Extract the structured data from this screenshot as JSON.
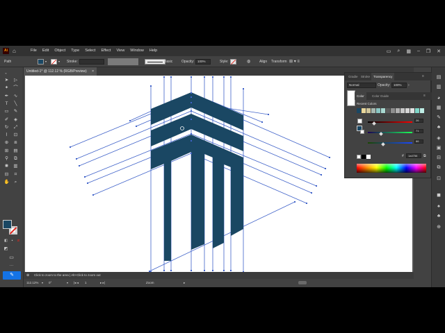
{
  "app": {
    "logo": "Ai",
    "menus": [
      "File",
      "Edit",
      "Object",
      "Type",
      "Select",
      "Effect",
      "View",
      "Window",
      "Help"
    ]
  },
  "control_bar": {
    "selection_label": "Path",
    "stroke_label": "Stroke:",
    "brush_label": "Basic",
    "opacity_label": "Opacity:",
    "opacity_value": "100%",
    "style_label": "Style:",
    "align_label": "Align",
    "transform_label": "Transform"
  },
  "document": {
    "tab_title": "Untitled-1* @ 112.12 % (RGB/Preview)",
    "close_glyph": "×"
  },
  "status": {
    "hint": "Click to zoom to the area  |  Alt+Click to zoom out",
    "zoom": "112.12%",
    "rotation": "0°",
    "artboard_num": "1",
    "tool_name": "Zoom"
  },
  "panels": {
    "top_tabs": [
      "Gradie",
      "Stroke",
      "Transparency"
    ],
    "blend_mode": "Normal",
    "opacity_label": "Opacity:",
    "opacity_value": "100%",
    "color_tabs": [
      "Color",
      "Color Guide"
    ],
    "recent_colors_label": "Recent Colors",
    "r_value": "26",
    "g_value": "71",
    "b_value": "86",
    "hex_label": "#",
    "hex_value": "1a4756"
  },
  "colors": {
    "accent_fill": "#1a4763",
    "guide_line": "#3f62c9",
    "recent": [
      "#1a4763",
      "#e9d79b",
      "#cfc59a",
      "#a7b8b0",
      "#8ac7c4",
      "#a8d8d0",
      "#5c5c5c",
      "#8f8f8f",
      "#b1b1b1",
      "#c9c9c9",
      "#d6d6d6",
      "#e2e2e2",
      "#7fd6c8",
      "#bfeee6"
    ]
  },
  "icons": {
    "home": "home-icon",
    "search": "search-icon",
    "zoom_tool": "zoom-icon",
    "edit_toolbar": "edit-toolbar-icon"
  }
}
